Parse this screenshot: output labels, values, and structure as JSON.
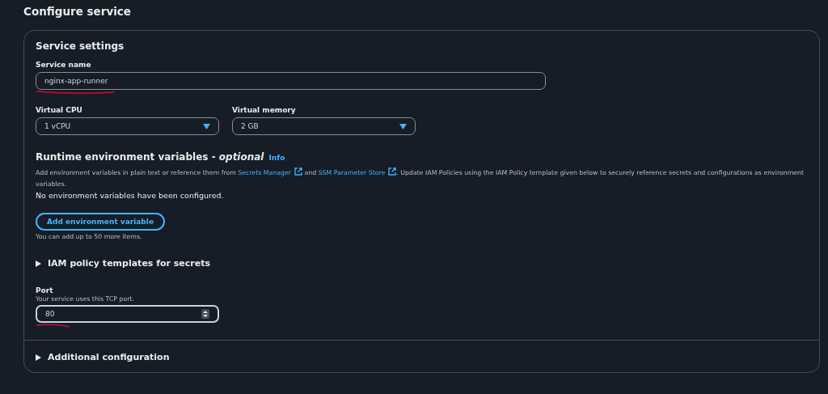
{
  "page_title": "Configure service",
  "card": {
    "title": "Service settings",
    "service_name": {
      "label": "Service name",
      "value": "nginx-app-runner"
    },
    "selects": [
      {
        "label": "Virtual CPU",
        "value": "1 vCPU"
      },
      {
        "label": "Virtual memory",
        "value": "2 GB"
      }
    ],
    "env": {
      "title": "Runtime environment variables - ",
      "optional": "optional",
      "info": "Info",
      "description": {
        "before": "Add environment variables in plain text or reference them from ",
        "link1": "Secrets Manager",
        "middle": " and ",
        "link2": "SSM Parameter Store",
        "after": ". Update IAM Policies using the IAM Policy template given below to securely reference secrets and configurations as environment variables."
      },
      "empty": "No environment variables have been configured.",
      "button": "Add environment variable",
      "hint": "You can add up to 50 more items."
    },
    "iam_expander": {
      "label": "IAM policy templates for secrets",
      "expanded": false
    },
    "port": {
      "label": "Port",
      "description": "Your service uses this TCP port.",
      "value": "80"
    },
    "additional_expander": {
      "label": "Additional configuration",
      "expanded": false
    }
  }
}
